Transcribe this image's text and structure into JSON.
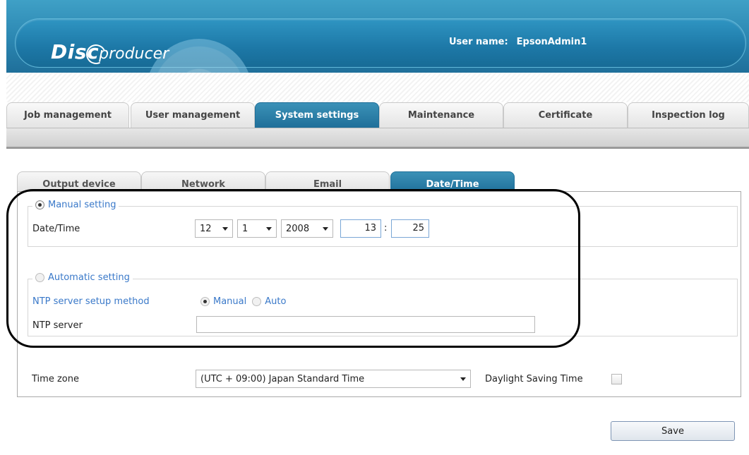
{
  "header": {
    "logo_disc": "Disc",
    "logo_producer": "producer",
    "user_label": "User name:",
    "user_name": "EpsonAdmin1"
  },
  "main_tabs": [
    {
      "label": "Job management"
    },
    {
      "label": "User management"
    },
    {
      "label": "System settings",
      "active": true
    },
    {
      "label": "Maintenance"
    },
    {
      "label": "Certificate"
    },
    {
      "label": "Inspection log"
    }
  ],
  "sub_tabs": [
    {
      "label": "Output device"
    },
    {
      "label": "Network"
    },
    {
      "label": "Email"
    },
    {
      "label": "Date/Time",
      "active": true
    }
  ],
  "manual": {
    "legend": "Manual setting",
    "selected": true,
    "datetime_label": "Date/Time",
    "month": "12",
    "day": "1",
    "year": "2008",
    "hour": "13",
    "colon": ":",
    "minute": "25"
  },
  "automatic": {
    "legend": "Automatic setting",
    "selected": false,
    "method_label": "NTP server setup method",
    "method_manual": "Manual",
    "method_auto": "Auto",
    "method_selected": "Manual",
    "server_label": "NTP server",
    "server_value": ""
  },
  "timezone": {
    "label": "Time zone",
    "value": "(UTC + 09:00) Japan Standard Time",
    "dst_label": "Daylight Saving Time",
    "dst_checked": false
  },
  "save_label": "Save",
  "colors": {
    "brand_blue": "#1f6f99",
    "label_blue": "#3a79c9"
  }
}
